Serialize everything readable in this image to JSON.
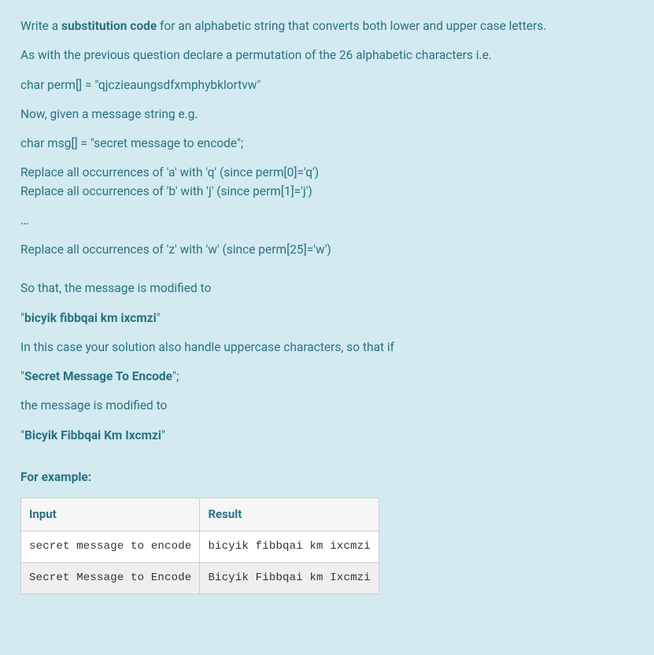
{
  "para1_pre": "Write a ",
  "para1_bold": "substitution code",
  "para1_post": " for an alphabetic string that converts both lower and upper case letters.",
  "para2": "As with the previous question declare a permutation of the 26 alphabetic characters i.e.",
  "para3": "char perm[] = \"qjczieaungsdfxmphybklortvw\"",
  "para4": "Now, given a message string e.g.",
  "para5": "char msg[] = \"secret message to encode\";",
  "para6a": "Replace all occurrences of 'a' with 'q'  (since perm[0]='q')",
  "para6b": "Replace  all occurrences of 'b' with 'j'  (since perm[1]='j')",
  "ellipsis": "…",
  "para7": "Replace all occurrences of 'z' with 'w' (since perm[25]='w')",
  "para8": "So that, the message is modified to",
  "para9_pre": "\"",
  "para9_bold": "bicyik fibbqai km ixcmzi",
  "para9_post": "\"",
  "para10": "In this case your solution also handle uppercase characters, so that if",
  "para11_pre": "\"",
  "para11_bold": "Secret Message To Encode",
  "para11_post": "\";",
  "para12": "the message is modified to",
  "para13_pre": "\"",
  "para13_bold": "Bicyik Fibbqai Km Ixcmzi",
  "para13_post": "\"",
  "for_example": "For example:",
  "table": {
    "headers": [
      "Input",
      "Result"
    ],
    "rows": [
      [
        "secret message to encode",
        "bicyik fibbqai km ixcmzi"
      ],
      [
        "Secret Message to Encode",
        "Bicyik Fibbqai km Ixcmzi"
      ]
    ]
  }
}
